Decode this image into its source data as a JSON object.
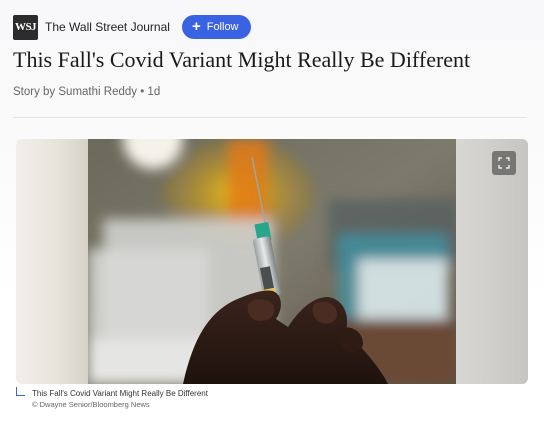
{
  "header": {
    "logo_text": "WSJ",
    "publisher_name": "The Wall Street Journal",
    "follow_label": "Follow",
    "follow_color": "#3a63e3"
  },
  "article": {
    "title": "This Fall's Covid Variant Might Really Be Different",
    "byline": "Story by Sumathi Reddy • 1d"
  },
  "image": {
    "expand_icon": "expand-icon",
    "caption": "This Fall's Covid Variant Might Really Be Different",
    "credit": "© Dwayne Senior/Bloomberg News"
  }
}
